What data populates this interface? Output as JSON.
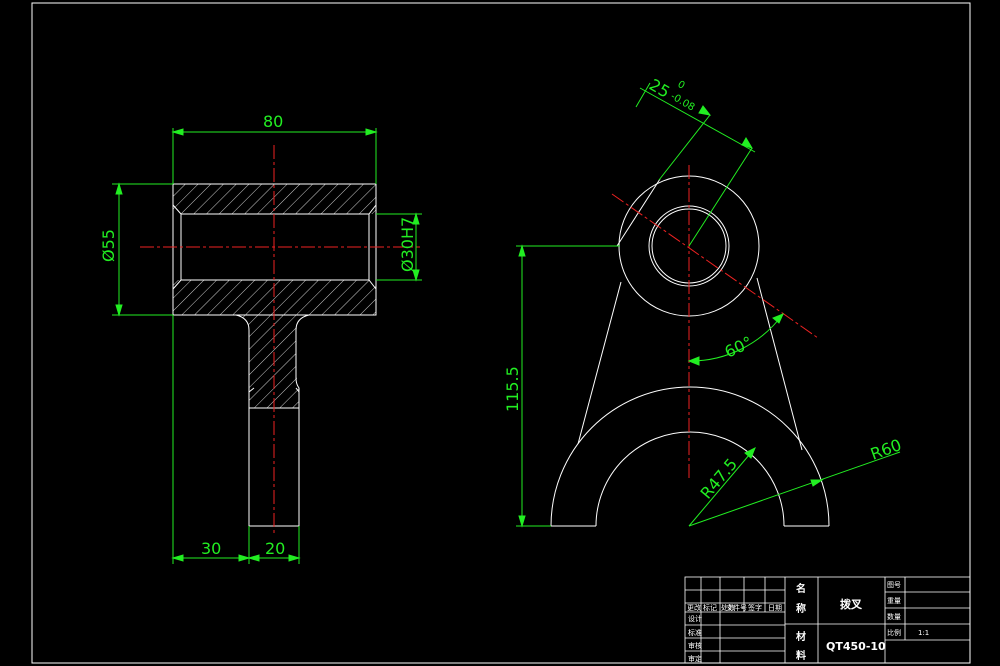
{
  "drawing": {
    "background": "#000000",
    "line_color": "#ffffff",
    "dimension_color": "#22ee22",
    "centerline_color": "#ee2222"
  },
  "left_view": {
    "dims": {
      "width": "80",
      "outer_dia": "Ø55",
      "bore_dia": "Ø30H7",
      "offset": "30",
      "stem": "20"
    }
  },
  "right_view": {
    "dims": {
      "thickness": "25",
      "tol_upper": "0",
      "tol_lower": "-0.08",
      "height": "115.5",
      "angle": "60°",
      "r_inner": "R47.5",
      "r_outer": "R60"
    }
  },
  "title_block": {
    "name_label_1": "名",
    "name_label_2": "称",
    "part_name": "拨叉",
    "material_label_1": "材",
    "material_label_2": "料",
    "material": "QT450-10",
    "right_labels": [
      "图号",
      "重量",
      "数量",
      "比例"
    ],
    "scale": "1:1",
    "header_cells": [
      "更改",
      "标记",
      "处数",
      "文件号",
      "签字",
      "日期"
    ],
    "rows": [
      "设计",
      "标准",
      "审核",
      "审定"
    ]
  }
}
